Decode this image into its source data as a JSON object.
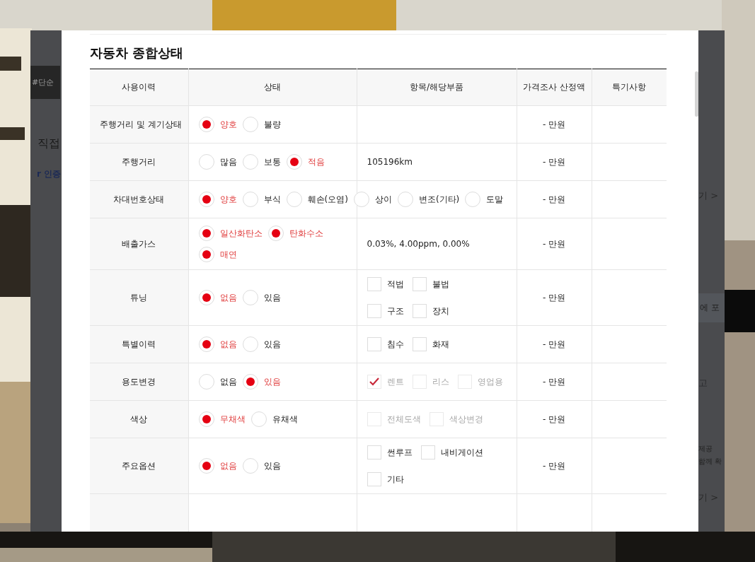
{
  "background_page": {
    "left_fragments": [
      {
        "text": "#단순",
        "kind": "tag"
      },
      {
        "text": "직접",
        "kind": "heading"
      },
      {
        "text": "r 인증",
        "kind": "accent"
      }
    ],
    "right_fragments": [
      {
        "text": "기 >",
        "kind": "link"
      },
      {
        "text": "에 포",
        "kind": "band"
      },
      {
        "text": "고",
        "kind": "plain"
      },
      {
        "text": "제공",
        "kind": "small"
      },
      {
        "text": "함께 확",
        "kind": "small"
      },
      {
        "text": "기 >",
        "kind": "link"
      }
    ]
  },
  "modal": {
    "title": "자동차 종합상태",
    "table": {
      "columns": [
        "사용이력",
        "상태",
        "항목/해당부품",
        "가격조사 산정액",
        "특기사항"
      ],
      "rows": [
        {
          "label": "주행거리 및 계기상태",
          "options": [
            [
              {
                "label": "양호",
                "selected": true
              },
              {
                "label": "불량",
                "selected": false
              }
            ]
          ],
          "price": "- 만원"
        },
        {
          "label": "주행거리",
          "options": [
            [
              {
                "label": "많음",
                "selected": false
              },
              {
                "label": "보통",
                "selected": false
              },
              {
                "label": "적음",
                "selected": true
              }
            ]
          ],
          "detail": {
            "kind": "text",
            "text": "105196km"
          },
          "price": "- 만원"
        },
        {
          "label": "차대번호상태",
          "options": [
            [
              {
                "label": "양호",
                "selected": true
              },
              {
                "label": "부식",
                "selected": false
              },
              {
                "label": "훼손(오염)",
                "selected": false
              },
              {
                "label": "상이",
                "selected": false
              },
              {
                "label": "변조(기타)",
                "selected": false
              },
              {
                "label": "도말",
                "selected": false
              }
            ]
          ],
          "price": "- 만원"
        },
        {
          "label": "배출가스",
          "options": [
            [
              {
                "label": "일산화탄소",
                "selected": true
              },
              {
                "label": "탄화수소",
                "selected": true
              }
            ],
            [
              {
                "label": "매연",
                "selected": true
              }
            ]
          ],
          "detail": {
            "kind": "text",
            "text": "0.03%, 4.00ppm, 0.00%"
          },
          "price": "- 만원"
        },
        {
          "label": "튜닝",
          "options": [
            [
              {
                "label": "없음",
                "selected": true
              },
              {
                "label": "있음",
                "selected": false
              }
            ]
          ],
          "detail": {
            "kind": "checks",
            "lines": [
              [
                {
                  "label": "적법",
                  "checked": false,
                  "disabled": false
                },
                {
                  "label": "불법",
                  "checked": false,
                  "disabled": false
                }
              ],
              [
                {
                  "label": "구조",
                  "checked": false,
                  "disabled": false
                },
                {
                  "label": "장치",
                  "checked": false,
                  "disabled": false
                }
              ]
            ]
          },
          "price": "- 만원"
        },
        {
          "label": "특별이력",
          "options": [
            [
              {
                "label": "없음",
                "selected": true
              },
              {
                "label": "있음",
                "selected": false
              }
            ]
          ],
          "detail": {
            "kind": "checks",
            "lines": [
              [
                {
                  "label": "침수",
                  "checked": false,
                  "disabled": false
                },
                {
                  "label": "화재",
                  "checked": false,
                  "disabled": false
                }
              ]
            ]
          },
          "price": "- 만원"
        },
        {
          "label": "용도변경",
          "options": [
            [
              {
                "label": "없음",
                "selected": false
              },
              {
                "label": "있음",
                "selected": true
              }
            ]
          ],
          "detail": {
            "kind": "checks",
            "lines": [
              [
                {
                  "label": "렌트",
                  "checked": true,
                  "disabled": true
                },
                {
                  "label": "리스",
                  "checked": false,
                  "disabled": true
                },
                {
                  "label": "영업용",
                  "checked": false,
                  "disabled": true
                }
              ]
            ]
          },
          "price": "- 만원"
        },
        {
          "label": "색상",
          "options": [
            [
              {
                "label": "무채색",
                "selected": true
              },
              {
                "label": "유채색",
                "selected": false
              }
            ]
          ],
          "detail": {
            "kind": "checks",
            "lines": [
              [
                {
                  "label": "전체도색",
                  "checked": false,
                  "disabled": true
                },
                {
                  "label": "색상변경",
                  "checked": false,
                  "disabled": true
                }
              ]
            ]
          },
          "price": "- 만원"
        },
        {
          "label": "주요옵션",
          "options": [
            [
              {
                "label": "없음",
                "selected": true
              },
              {
                "label": "있음",
                "selected": false
              }
            ]
          ],
          "detail": {
            "kind": "checks",
            "lines": [
              [
                {
                  "label": "썬루프",
                  "checked": false,
                  "disabled": false
                },
                {
                  "label": "내비게이션",
                  "checked": false,
                  "disabled": false
                }
              ],
              [
                {
                  "label": "기타",
                  "checked": false,
                  "disabled": false
                }
              ]
            ]
          },
          "price": "- 만원"
        }
      ]
    }
  }
}
